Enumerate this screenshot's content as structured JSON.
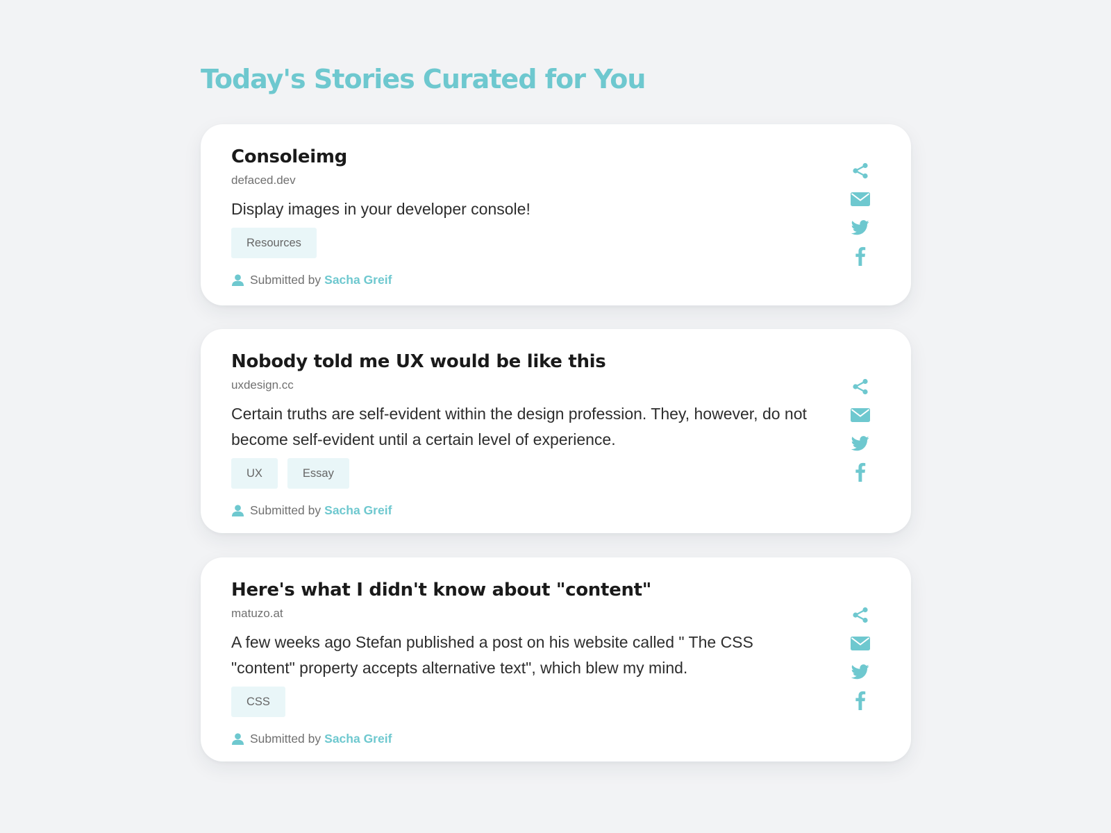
{
  "page": {
    "title": "Today's Stories Curated for You"
  },
  "colors": {
    "accent": "#6ec8cf",
    "tag_bg": "#e9f6f8",
    "background": "#f2f3f5"
  },
  "stories": [
    {
      "title": "Consoleimg",
      "domain": "defaced.dev",
      "description": "Display images in your developer console!",
      "tags": [
        "Resources"
      ],
      "submitted_label": "Submitted by",
      "author": "Sacha Greif"
    },
    {
      "title": "Nobody told me UX would be like this",
      "domain": "uxdesign.cc",
      "description": "Certain truths are self-evident within the design profession. They, however, do not become self-evident until a certain level of experience.",
      "tags": [
        "UX",
        "Essay"
      ],
      "submitted_label": "Submitted by",
      "author": "Sacha Greif"
    },
    {
      "title": "Here's what I didn't know about \"content\"",
      "domain": "matuzo.at",
      "description": "A few weeks ago Stefan published a post on his website called \" The CSS \"content\" property accepts alternative text\", which blew my mind.",
      "tags": [
        "CSS"
      ],
      "submitted_label": "Submitted by",
      "author": "Sacha Greif"
    }
  ],
  "share_icons": [
    "share-icon",
    "email-icon",
    "twitter-icon",
    "facebook-icon"
  ]
}
